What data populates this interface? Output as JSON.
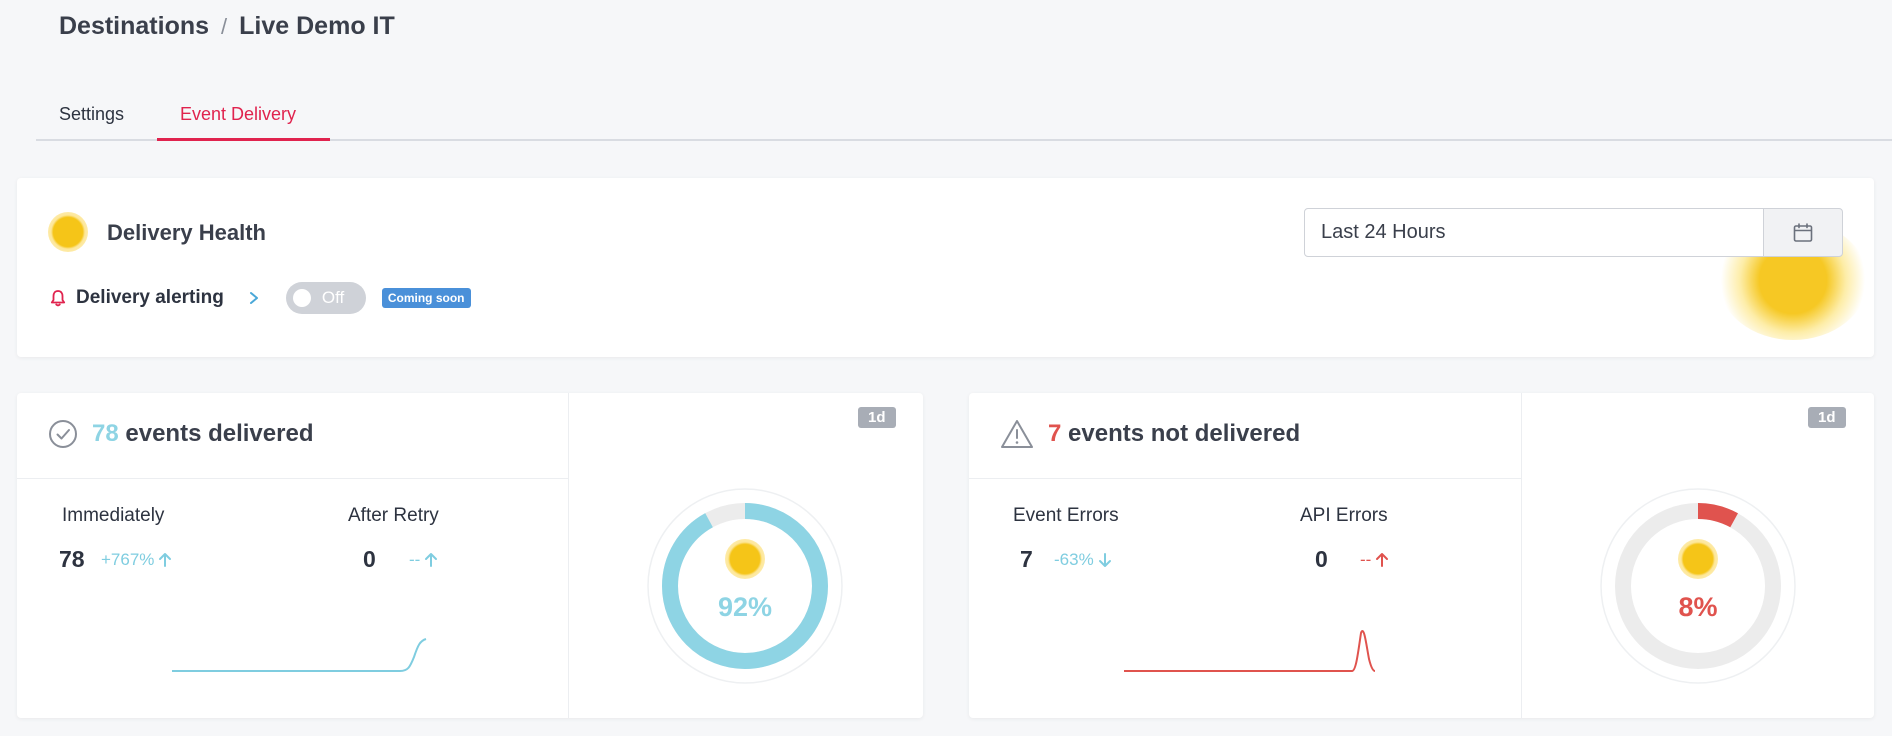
{
  "breadcrumb": {
    "parent": "Destinations",
    "separator": "/",
    "current": "Live Demo IT"
  },
  "tabs": [
    {
      "label": "Settings"
    },
    {
      "label": "Event Delivery"
    }
  ],
  "health": {
    "title": "Delivery Health",
    "alerting_label": "Delivery alerting",
    "toggle_label": "Off",
    "badge": "Coming soon",
    "date_range": "Last 24 Hours"
  },
  "delivered": {
    "count": "78",
    "label": "events delivered",
    "period_badge": "1d",
    "metrics": [
      {
        "label": "Immediately",
        "value": "78",
        "delta": "+767%",
        "trend": "up"
      },
      {
        "label": "After Retry",
        "value": "0",
        "delta": "--",
        "trend": "up"
      }
    ],
    "donut_percent": "92%",
    "donut_fraction": 0.92,
    "color": "#8ed4e4"
  },
  "not_delivered": {
    "count": "7",
    "label": "events not delivered",
    "period_badge": "1d",
    "metrics": [
      {
        "label": "Event Errors",
        "value": "7",
        "delta": "-63%",
        "trend": "down"
      },
      {
        "label": "API Errors",
        "value": "0",
        "delta": "--",
        "trend": "up"
      }
    ],
    "donut_percent": "8%",
    "donut_fraction": 0.08,
    "color": "#e0534e"
  }
}
